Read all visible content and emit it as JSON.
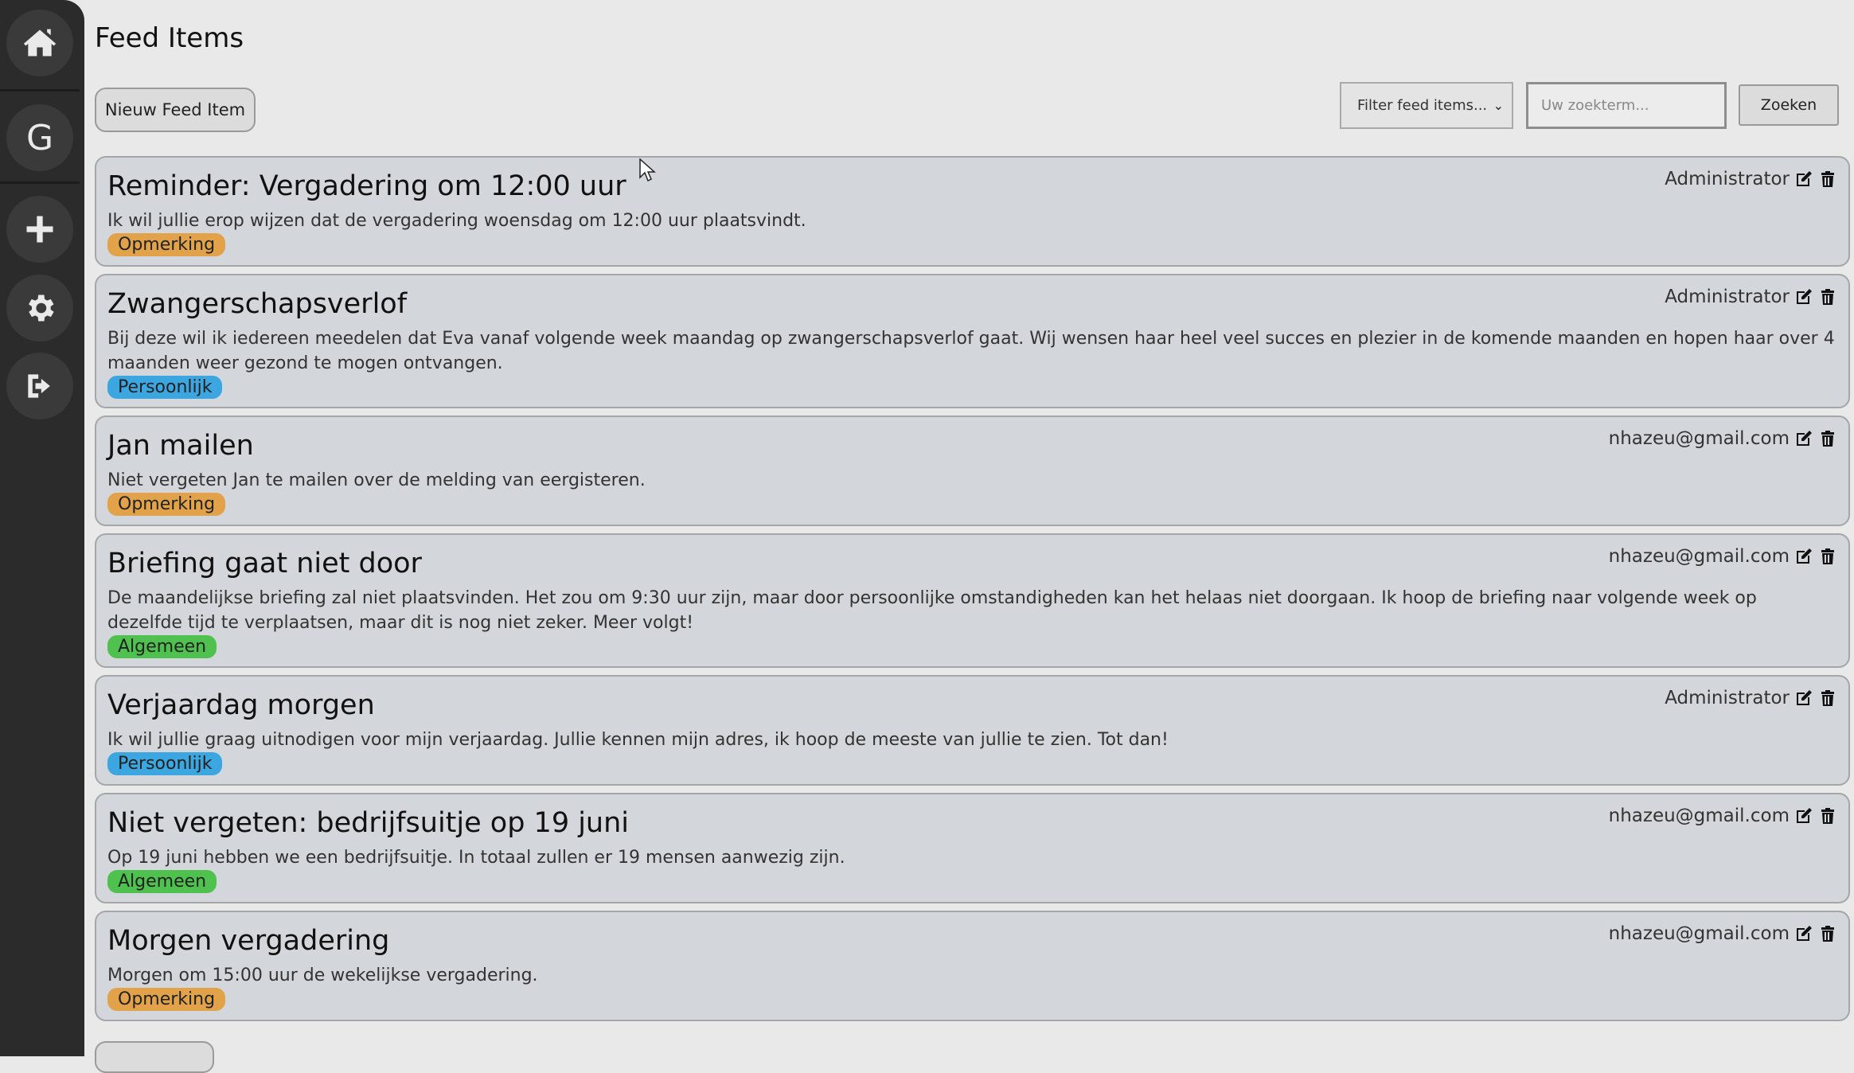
{
  "sidebar": {
    "items": [
      {
        "name": "home",
        "icon": "home-icon"
      },
      {
        "name": "g",
        "label": "G"
      },
      {
        "name": "add",
        "icon": "plus-icon"
      },
      {
        "name": "settings",
        "icon": "gear-icon"
      },
      {
        "name": "logout",
        "icon": "logout-icon"
      }
    ]
  },
  "header": {
    "title": "Feed Items",
    "new_button": "Nieuw Feed Item"
  },
  "filter": {
    "select_value": "Filter feed items...",
    "search_placeholder": "Uw zoekterm...",
    "search_button": "Zoeken"
  },
  "colors": {
    "Opmerking": "#e1a24a",
    "Persoonlijk": "#3ba6df",
    "Algemeen": "#4fc14f"
  },
  "feed": [
    {
      "title": "Reminder: Vergadering om 12:00 uur",
      "body": "Ik wil jullie erop wijzen dat de vergadering woensdag om 12:00 uur plaatsvindt.",
      "tag": "Opmerking",
      "author": "Administrator"
    },
    {
      "title": "Zwangerschapsverlof",
      "body": "Bij deze wil ik iedereen meedelen dat Eva vanaf volgende week maandag op zwangerschapsverlof gaat. Wij wensen haar heel veel succes en plezier in de komende maanden en hopen haar over 4 maanden weer gezond te mogen ontvangen.",
      "tag": "Persoonlijk",
      "author": "Administrator"
    },
    {
      "title": "Jan mailen",
      "body": "Niet vergeten Jan te mailen over de melding van eergisteren.",
      "tag": "Opmerking",
      "author": "nhazeu@gmail.com"
    },
    {
      "title": "Briefing gaat niet door",
      "body": "De maandelijkse briefing zal niet plaatsvinden. Het zou om 9:30 uur zijn, maar door persoonlijke omstandigheden kan het helaas niet doorgaan. Ik hoop de briefing naar volgende week op dezelfde tijd te verplaatsen, maar dit is nog niet zeker. Meer volgt!",
      "tag": "Algemeen",
      "author": "nhazeu@gmail.com"
    },
    {
      "title": "Verjaardag morgen",
      "body": "Ik wil jullie graag uitnodigen voor mijn verjaardag. Jullie kennen mijn adres, ik hoop de meeste van jullie te zien. Tot dan!",
      "tag": "Persoonlijk",
      "author": "Administrator"
    },
    {
      "title": "Niet vergeten: bedrijfsuitje op 19 juni",
      "body": "Op 19 juni hebben we een bedrijfsuitje. In totaal zullen er 19 mensen aanwezig zijn.",
      "tag": "Algemeen",
      "author": "nhazeu@gmail.com"
    },
    {
      "title": "Morgen vergadering",
      "body": "Morgen om 15:00 uur de wekelijkse vergadering.",
      "tag": "Opmerking",
      "author": "nhazeu@gmail.com"
    }
  ]
}
